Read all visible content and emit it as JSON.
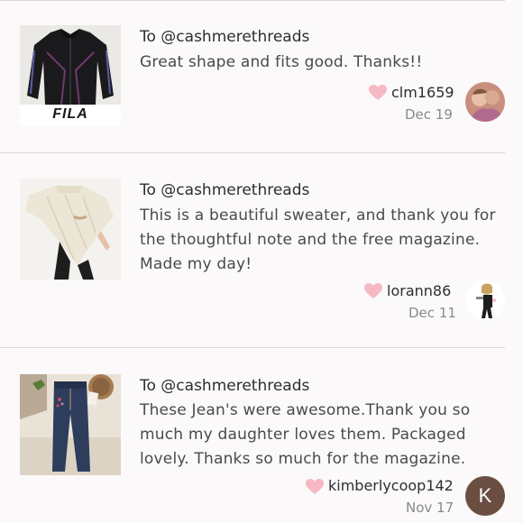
{
  "reviews": [
    {
      "to": "To @cashmerethreads",
      "text": "Great shape and fits good. Thanks!!",
      "username": "clm1659",
      "date": "Dec 19",
      "thumb_icon": "black-track-jacket-photo",
      "brand_logo": "FILA"
    },
    {
      "to": "To @cashmerethreads",
      "text": "This is a beautiful sweater, and thank you for the thoughtful note and the free magazine. Made my day!",
      "username": "lorann86",
      "date": "Dec 11",
      "thumb_icon": "cream-knit-poncho-photo"
    },
    {
      "to": "To @cashmerethreads",
      "text": "These Jean's were awesome.Thank you so much my daughter loves them. Packaged lovely. Thanks so much for the magazine.",
      "username": "kimberlycoop142",
      "date": "Nov 17",
      "thumb_icon": "embroidered-jeans-photo",
      "avatar_letter": "K"
    }
  ],
  "colors": {
    "heart": "#f6b9c3",
    "background": "#fbf9fa",
    "divider": "#d9d6d7",
    "avatar_k": "#6b4e42"
  }
}
